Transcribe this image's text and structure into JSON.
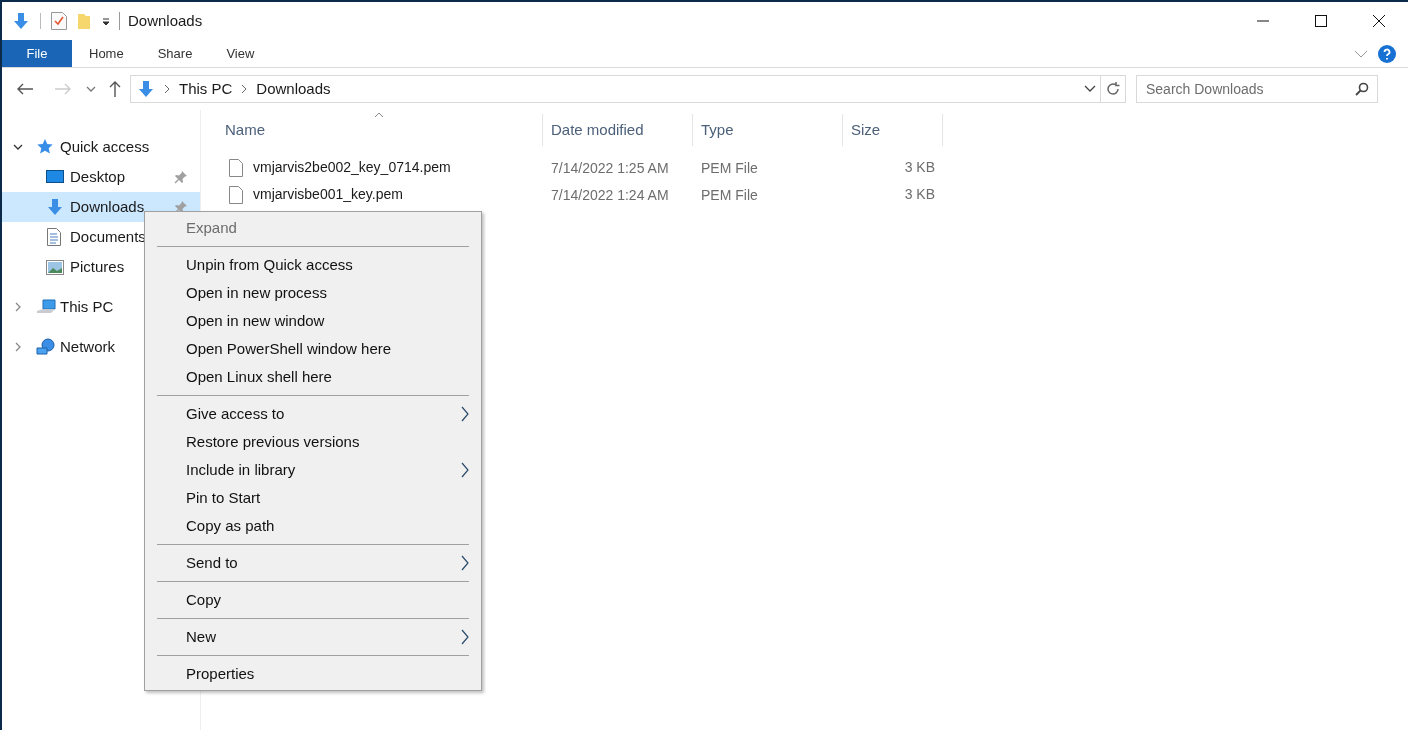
{
  "window": {
    "title": "Downloads"
  },
  "ribbon_tabs": [
    {
      "label": "File",
      "selected": true
    },
    {
      "label": "Home",
      "selected": false
    },
    {
      "label": "Share",
      "selected": false
    },
    {
      "label": "View",
      "selected": false
    }
  ],
  "address": {
    "path": [
      "This PC",
      "Downloads"
    ]
  },
  "search": {
    "placeholder": "Search Downloads"
  },
  "sidebar": {
    "items": [
      {
        "label": "Quick access",
        "expanded": true,
        "selected": false,
        "children": [
          {
            "label": "Desktop",
            "pinned": true,
            "selected": false
          },
          {
            "label": "Downloads",
            "pinned": true,
            "selected": true
          },
          {
            "label": "Documents",
            "selected": false
          },
          {
            "label": "Pictures",
            "selected": false
          }
        ]
      },
      {
        "label": "This PC",
        "expanded": false,
        "selected": false
      },
      {
        "label": "Network",
        "expanded": false,
        "selected": false
      }
    ]
  },
  "table": {
    "columns": [
      "Name",
      "Date modified",
      "Type",
      "Size"
    ],
    "rows": [
      {
        "name": "vmjarvis2be002_key_0714.pem",
        "date": "7/14/2022 1:25 AM",
        "type": "PEM File",
        "size": "3 KB"
      },
      {
        "name": "vmjarvisbe001_key.pem",
        "date": "7/14/2022 1:24 AM",
        "type": "PEM File",
        "size": "3 KB"
      }
    ]
  },
  "context_menu": {
    "groups": [
      [
        {
          "label": "Expand",
          "disabled": true,
          "submenu": false
        }
      ],
      [
        {
          "label": "Unpin from Quick access",
          "disabled": false,
          "submenu": false
        },
        {
          "label": "Open in new process",
          "disabled": false,
          "submenu": false
        },
        {
          "label": "Open in new window",
          "disabled": false,
          "submenu": false
        },
        {
          "label": "Open PowerShell window here",
          "disabled": false,
          "submenu": false
        },
        {
          "label": "Open Linux shell here",
          "disabled": false,
          "submenu": false
        }
      ],
      [
        {
          "label": "Give access to",
          "disabled": false,
          "submenu": true
        },
        {
          "label": "Restore previous versions",
          "disabled": false,
          "submenu": false
        },
        {
          "label": "Include in library",
          "disabled": false,
          "submenu": true
        },
        {
          "label": "Pin to Start",
          "disabled": false,
          "submenu": false
        },
        {
          "label": "Copy as path",
          "disabled": false,
          "submenu": false
        }
      ],
      [
        {
          "label": "Send to",
          "disabled": false,
          "submenu": true
        }
      ],
      [
        {
          "label": "Copy",
          "disabled": false,
          "submenu": false
        }
      ],
      [
        {
          "label": "New",
          "disabled": false,
          "submenu": true
        }
      ],
      [
        {
          "label": "Properties",
          "disabled": false,
          "submenu": false
        }
      ]
    ]
  }
}
